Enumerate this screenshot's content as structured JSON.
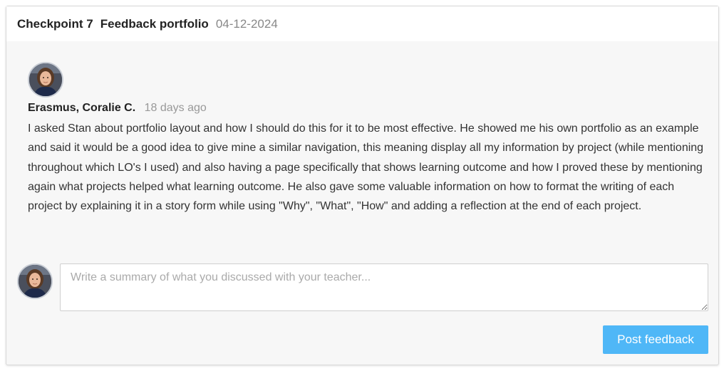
{
  "header": {
    "checkpoint": "Checkpoint 7",
    "title": "Feedback portfolio",
    "date": "04-12-2024"
  },
  "comment": {
    "avatar_icon": "user-avatar-photo",
    "author": "Erasmus, Coralie C.",
    "time": "18 days ago",
    "body": "I asked Stan about portfolio layout and how I should do this for it to be most effective. He showed me his own portfolio as an example and said it would be a good idea to give mine a similar navigation, this meaning display all my information by project (while mentioning throughout which LO's I used) and also having a page specifically that shows learning outcome and how I proved these by mentioning again what projects helped what learning outcome. He also gave some valuable information on how to format the writing of each project by explaining it in a story form while using \"Why\", \"What\", \"How\" and adding a reflection at the end of each project."
  },
  "reply": {
    "avatar_icon": "user-avatar-photo",
    "value": "",
    "placeholder": "Write a summary of what you discussed with your teacher...",
    "button_label": "Post feedback"
  },
  "colors": {
    "card_background": "#f7f7f7",
    "header_background": "#ffffff",
    "button_background": "#4fb7f7",
    "muted_text": "#888888"
  }
}
